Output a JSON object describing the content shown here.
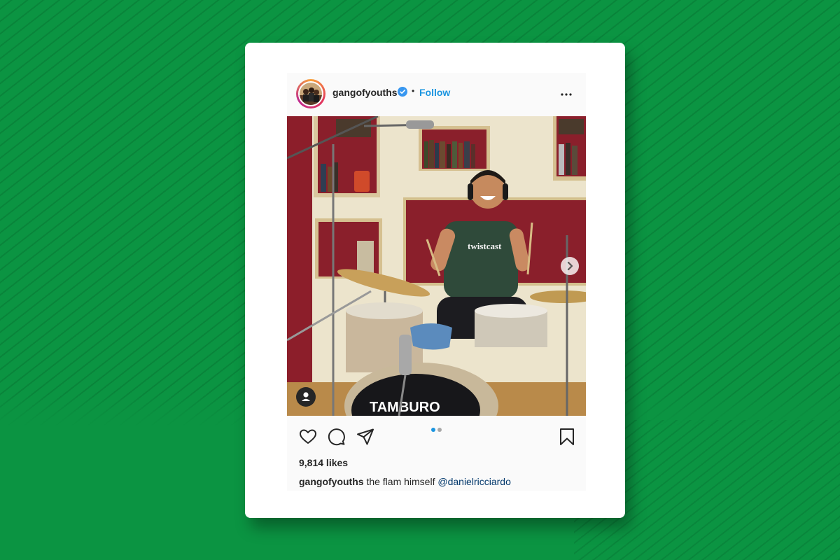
{
  "post": {
    "username": "gangofyouths",
    "follow_label": "Follow",
    "separator": "•",
    "likes": "9,814 likes",
    "caption": {
      "username": "gangofyouths",
      "text": "the flam himself",
      "mention": "@danielricciardo"
    },
    "carousel": {
      "current_index": 1,
      "total": 2
    },
    "shirt_text": "twistcast",
    "drum_logo_text": "TAMBURO"
  },
  "icons": {
    "more": "more-options-icon",
    "verified": "verified-badge-icon",
    "like": "heart-icon",
    "comment": "comment-icon",
    "share": "paper-plane-icon",
    "save": "bookmark-icon",
    "next": "chevron-right-icon",
    "tag": "user-tag-icon"
  },
  "colors": {
    "background": "#0b9442",
    "follow": "#1b95e0",
    "mention": "#00376b",
    "dot_active": "#1b95e0"
  }
}
